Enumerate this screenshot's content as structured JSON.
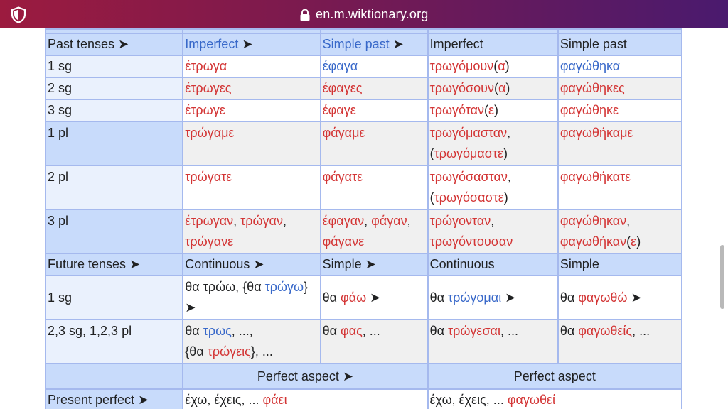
{
  "browser": {
    "url": "en.m.wiktionary.org"
  },
  "table": {
    "top_row": [
      "",
      "",
      "",
      "",
      ""
    ],
    "past": {
      "header": {
        "label": "Past tenses ➤",
        "c1": "Imperfect",
        "c1_arrow": " ➤",
        "c2": "Simple past",
        "c2_arrow": " ➤",
        "c3": "Imperfect",
        "c4": "Simple past"
      },
      "r1": {
        "label": "1 sg",
        "c1": "έτρωγα",
        "c2": "έφαγα",
        "c3a": "τρωγόμουν",
        "c3b": "(",
        "c3c": "α",
        "c3d": ")",
        "c4": "φαγώθηκα"
      },
      "r2": {
        "label": "2 sg",
        "c1": "έτρωγες",
        "c2": "έφαγες",
        "c3a": "τρωγόσουν",
        "c3b": "(",
        "c3c": "α",
        "c3d": ")",
        "c4": "φαγώθηκες"
      },
      "r3": {
        "label": "3 sg",
        "c1": "έτρωγε",
        "c2": "έφαγε",
        "c3a": "τρωγόταν",
        "c3b": "(",
        "c3c": "ε",
        "c3d": ")",
        "c4": "φαγώθηκε"
      },
      "r4": {
        "label": "1 pl",
        "c1": "τρώγαμε",
        "c2": "φάγαμε",
        "c3a": "τρωγόμασταν",
        "c3b": ",",
        "c3c": "(",
        "c3d": "τρωγόμαστε",
        "c3e": ")",
        "c4": "φαγωθήκαμε"
      },
      "r5": {
        "label": "2 pl",
        "c1": "τρώγατε",
        "c2": "φάγατε",
        "c3a": "τρωγόσασταν",
        "c3b": ",",
        "c3c": "(",
        "c3d": "τρωγόσαστε",
        "c3e": ")",
        "c4": "φαγωθήκατε"
      },
      "r6": {
        "label": "3 pl",
        "c1a": "έτρωγαν",
        "c1b": ", ",
        "c1c": "τρώγαν",
        "c1d": ",",
        "c1e": "τρώγανε",
        "c2a": "έφαγαν",
        "c2b": ", ",
        "c2c": "φάγαν",
        "c2d": ",",
        "c2e": "φάγανε",
        "c3a": "τρώγονταν",
        "c3b": ",",
        "c3c": "τρωγόντουσαν",
        "c4a": "φαγώθηκαν",
        "c4b": ",",
        "c4c": "φαγωθήκαν",
        "c4d": "(",
        "c4e": "ε",
        "c4f": ")"
      }
    },
    "future": {
      "header": {
        "label": "Future tenses ➤",
        "c1": "Continuous ➤",
        "c2": "Simple ➤",
        "c3": "Continuous",
        "c4": "Simple"
      },
      "r1": {
        "label": "1 sg",
        "c1a": "θα τρώω, {θα ",
        "c1b": "τρώγω",
        "c1c": "}",
        "c1d": "➤",
        "c2a": "θα ",
        "c2b": "φάω",
        "c2c": " ➤",
        "c3a": "θα ",
        "c3b": "τρώγομαι",
        "c3c": " ➤",
        "c4a": "θα ",
        "c4b": "φαγωθώ",
        "c4c": " ➤"
      },
      "r2": {
        "label": "2,3 sg, 1,2,3 pl",
        "c1a": "θα ",
        "c1b": "τρως",
        "c1c": ", ...,",
        "c1d": "{θα ",
        "c1e": "τρώγεις",
        "c1f": "}, ...",
        "c2a": "θα ",
        "c2b": "φας",
        "c2c": ", ...",
        "c3a": "θα ",
        "c3b": "τρώγεσαι",
        "c3c": ", ...",
        "c4a": "θα ",
        "c4b": "φαγωθείς",
        "c4c": ", ..."
      }
    },
    "perfect": {
      "header": {
        "label": "",
        "c1": "Perfect aspect ➤",
        "c2": "Perfect aspect"
      },
      "r1": {
        "label": "Present perfect ➤",
        "c1a": "έχω, έχεις, ... ",
        "c1b": "φάει",
        "c2a": "έχω, έχεις, ... ",
        "c2b": "φαγωθεί"
      }
    }
  }
}
